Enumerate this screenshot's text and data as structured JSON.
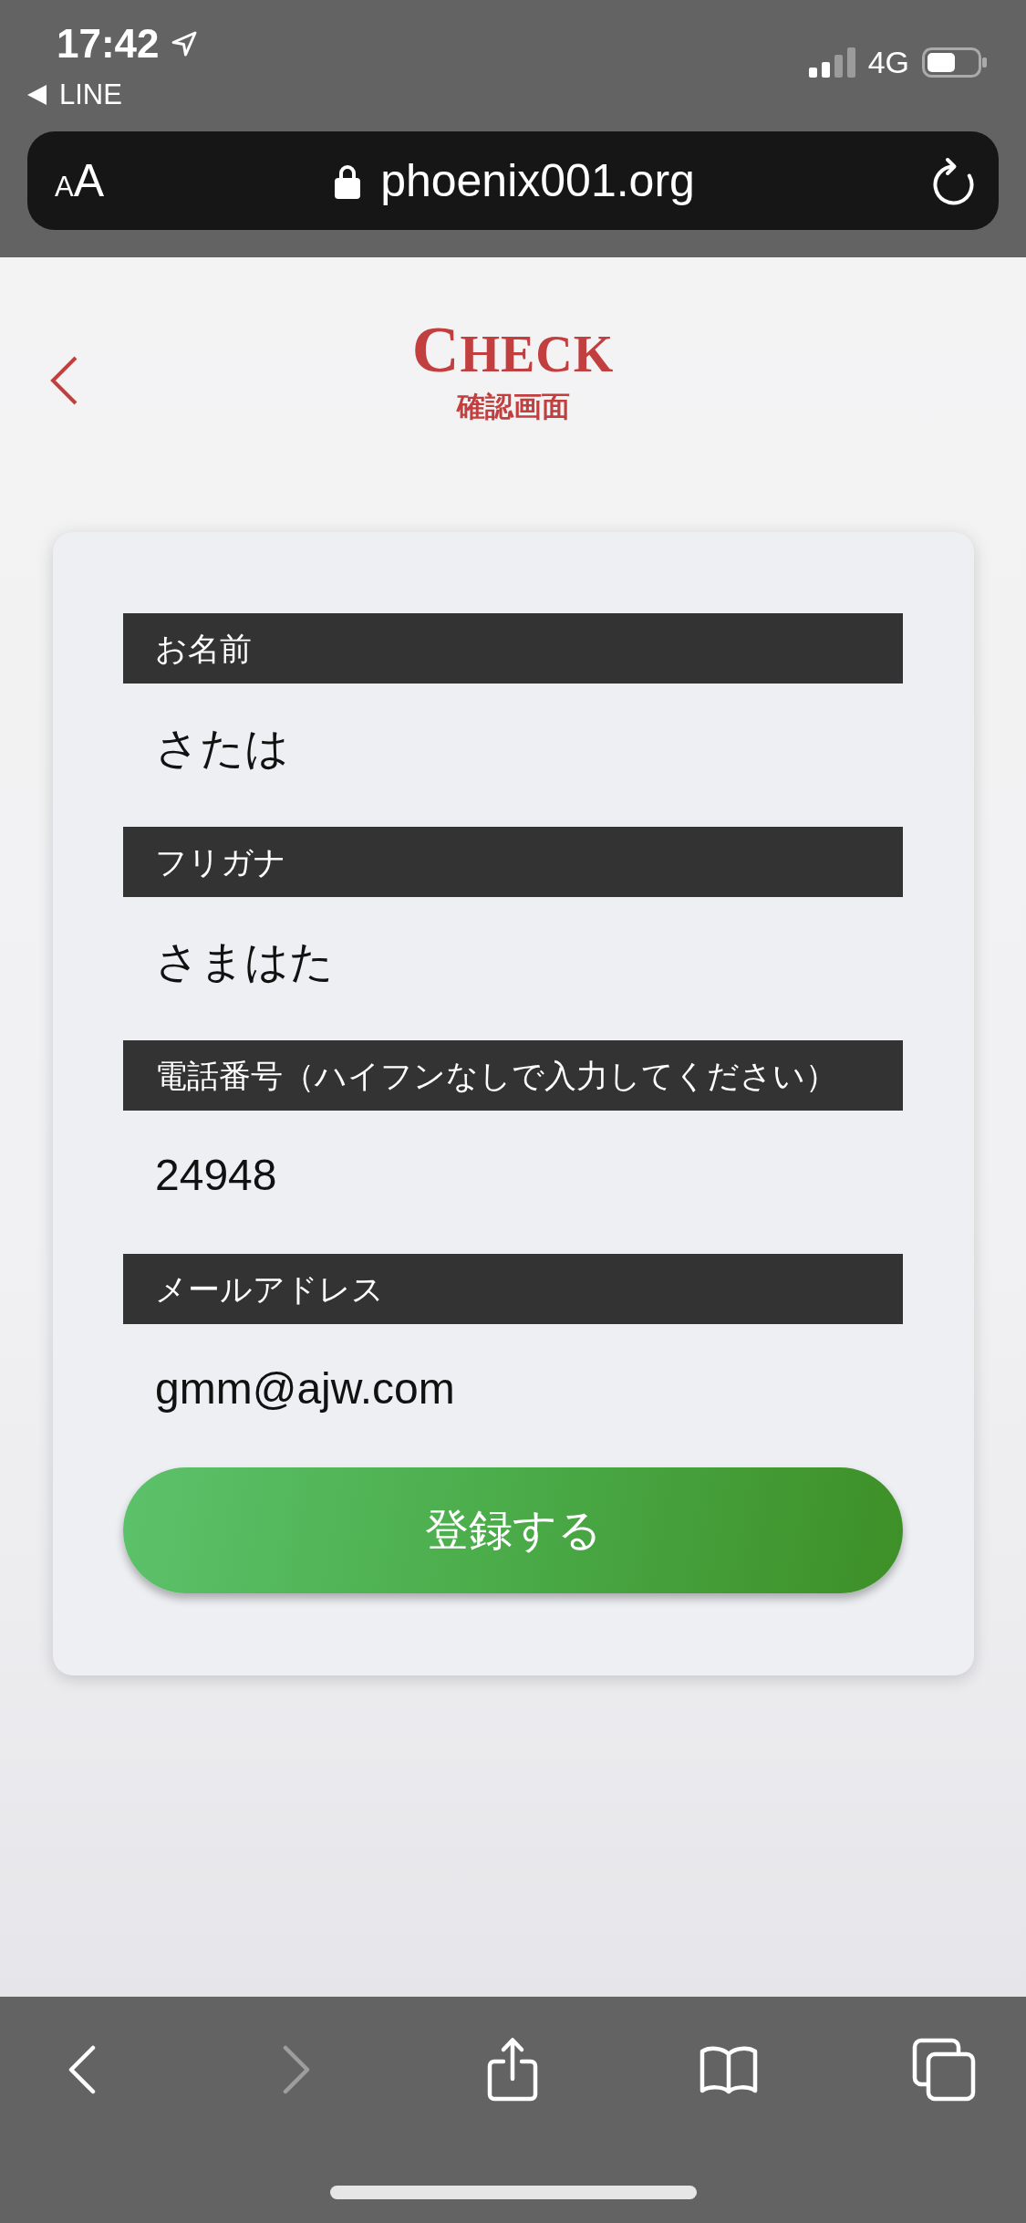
{
  "status_bar": {
    "time": "17:42",
    "back_app": "LINE",
    "network": "4G"
  },
  "address_bar": {
    "text_size_button": "AA",
    "url": "phoenix001.org"
  },
  "header": {
    "title": "CHECK",
    "subtitle": "確認画面"
  },
  "fields": [
    {
      "label": "お名前",
      "value": "さたは"
    },
    {
      "label": "フリガナ",
      "value": "さまはた"
    },
    {
      "label": "電話番号（ハイフンなしで入力してください）",
      "value": "24948"
    },
    {
      "label": "メールアドレス",
      "value": "gmm@ajw.com"
    }
  ],
  "submit_button": "登録する",
  "toolbar": {
    "items": [
      {
        "kind": "back",
        "disabled": false
      },
      {
        "kind": "forward",
        "disabled": true
      },
      {
        "kind": "share",
        "disabled": false
      },
      {
        "kind": "bookmarks",
        "disabled": false
      },
      {
        "kind": "tabs",
        "disabled": false
      }
    ]
  }
}
